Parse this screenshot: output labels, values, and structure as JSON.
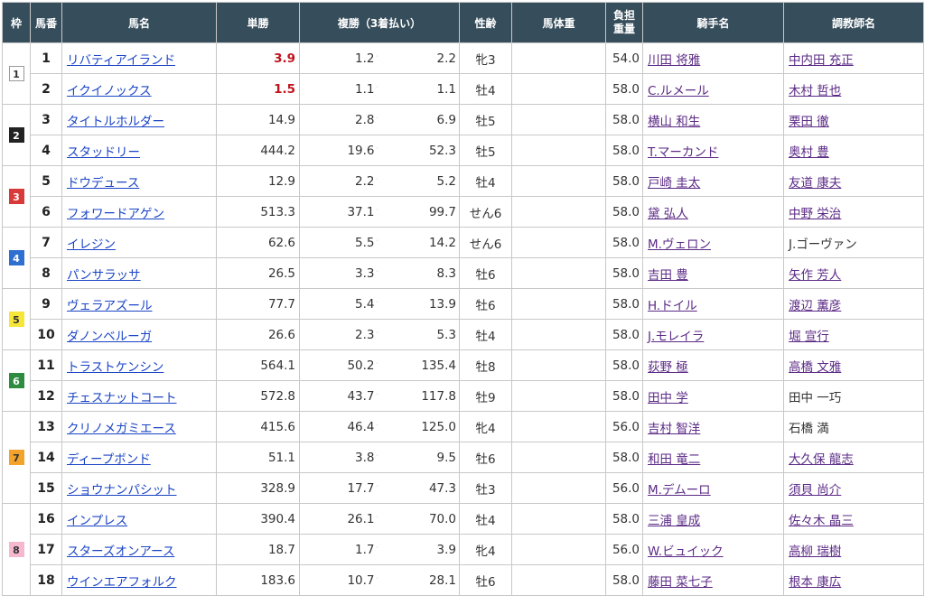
{
  "headers": {
    "waku": "枠",
    "umaban": "馬番",
    "horse": "馬名",
    "win": "単勝",
    "place": "複勝（3着払い）",
    "sexage": "性齢",
    "bodyweight": "馬体重",
    "burden_1": "負担",
    "burden_2": "重量",
    "jockey": "騎手名",
    "trainer": "調教師名"
  },
  "waku_colors": {
    "1": {
      "bg": "#ffffff",
      "fg": "#333333",
      "border": "#999999"
    },
    "2": {
      "bg": "#222222",
      "fg": "#ffffff",
      "border": "#222222"
    },
    "3": {
      "bg": "#d83a3a",
      "fg": "#ffffff",
      "border": "#d83a3a"
    },
    "4": {
      "bg": "#2f6fd0",
      "fg": "#ffffff",
      "border": "#2f6fd0"
    },
    "5": {
      "bg": "#f6e63a",
      "fg": "#333333",
      "border": "#f6e63a"
    },
    "6": {
      "bg": "#2e8b3f",
      "fg": "#ffffff",
      "border": "#2e8b3f"
    },
    "7": {
      "bg": "#f3a32a",
      "fg": "#333333",
      "border": "#f3a32a"
    },
    "8": {
      "bg": "#f5b8cf",
      "fg": "#333333",
      "border": "#f5b8cf"
    }
  },
  "rows": [
    {
      "waku": "1",
      "num": "1",
      "horse": "リバティアイランド",
      "win": "3.9",
      "fav": true,
      "plo": "1.2",
      "phi": "2.2",
      "sex": "牝3",
      "bw": "",
      "wt": "54.0",
      "jockey": "川田 将雅",
      "jockey_link": true,
      "trainer": "中内田 充正",
      "trainer_link": true
    },
    {
      "waku": "1",
      "num": "2",
      "horse": "イクイノックス",
      "win": "1.5",
      "fav": true,
      "plo": "1.1",
      "phi": "1.1",
      "sex": "牡4",
      "bw": "",
      "wt": "58.0",
      "jockey": "C.ルメール",
      "jockey_link": true,
      "trainer": "木村 哲也",
      "trainer_link": true
    },
    {
      "waku": "2",
      "num": "3",
      "horse": "タイトルホルダー",
      "win": "14.9",
      "fav": false,
      "plo": "2.8",
      "phi": "6.9",
      "sex": "牡5",
      "bw": "",
      "wt": "58.0",
      "jockey": "横山 和生",
      "jockey_link": true,
      "trainer": "栗田 徹",
      "trainer_link": true
    },
    {
      "waku": "2",
      "num": "4",
      "horse": "スタッドリー",
      "win": "444.2",
      "fav": false,
      "plo": "19.6",
      "phi": "52.3",
      "sex": "牡5",
      "bw": "",
      "wt": "58.0",
      "jockey": "T.マーカンド",
      "jockey_link": true,
      "trainer": "奥村 豊",
      "trainer_link": true
    },
    {
      "waku": "3",
      "num": "5",
      "horse": "ドウデュース",
      "win": "12.9",
      "fav": false,
      "plo": "2.2",
      "phi": "5.2",
      "sex": "牡4",
      "bw": "",
      "wt": "58.0",
      "jockey": "戸崎 圭太",
      "jockey_link": true,
      "trainer": "友道 康夫",
      "trainer_link": true
    },
    {
      "waku": "3",
      "num": "6",
      "horse": "フォワードアゲン",
      "win": "513.3",
      "fav": false,
      "plo": "37.1",
      "phi": "99.7",
      "sex": "せん6",
      "bw": "",
      "wt": "58.0",
      "jockey": "黛 弘人",
      "jockey_link": true,
      "trainer": "中野 栄治",
      "trainer_link": true
    },
    {
      "waku": "4",
      "num": "7",
      "horse": "イレジン",
      "win": "62.6",
      "fav": false,
      "plo": "5.5",
      "phi": "14.2",
      "sex": "せん6",
      "bw": "",
      "wt": "58.0",
      "jockey": "M.ヴェロン",
      "jockey_link": true,
      "trainer": "J.ゴーヴァン",
      "trainer_link": false
    },
    {
      "waku": "4",
      "num": "8",
      "horse": "パンサラッサ",
      "win": "26.5",
      "fav": false,
      "plo": "3.3",
      "phi": "8.3",
      "sex": "牡6",
      "bw": "",
      "wt": "58.0",
      "jockey": "吉田 豊",
      "jockey_link": true,
      "trainer": "矢作 芳人",
      "trainer_link": true
    },
    {
      "waku": "5",
      "num": "9",
      "horse": "ヴェラアズール",
      "win": "77.7",
      "fav": false,
      "plo": "5.4",
      "phi": "13.9",
      "sex": "牡6",
      "bw": "",
      "wt": "58.0",
      "jockey": "H.ドイル",
      "jockey_link": true,
      "trainer": "渡辺 薫彦",
      "trainer_link": true
    },
    {
      "waku": "5",
      "num": "10",
      "horse": "ダノンベルーガ",
      "win": "26.6",
      "fav": false,
      "plo": "2.3",
      "phi": "5.3",
      "sex": "牡4",
      "bw": "",
      "wt": "58.0",
      "jockey": "J.モレイラ",
      "jockey_link": true,
      "trainer": "堀 宣行",
      "trainer_link": true
    },
    {
      "waku": "6",
      "num": "11",
      "horse": "トラストケンシン",
      "win": "564.1",
      "fav": false,
      "plo": "50.2",
      "phi": "135.4",
      "sex": "牡8",
      "bw": "",
      "wt": "58.0",
      "jockey": "荻野 極",
      "jockey_link": true,
      "trainer": "高橋 文雅",
      "trainer_link": true
    },
    {
      "waku": "6",
      "num": "12",
      "horse": "チェスナットコート",
      "win": "572.8",
      "fav": false,
      "plo": "43.7",
      "phi": "117.8",
      "sex": "牡9",
      "bw": "",
      "wt": "58.0",
      "jockey": "田中 学",
      "jockey_link": true,
      "trainer": "田中 一巧",
      "trainer_link": false
    },
    {
      "waku": "7",
      "num": "13",
      "horse": "クリノメガミエース",
      "win": "415.6",
      "fav": false,
      "plo": "46.4",
      "phi": "125.0",
      "sex": "牝4",
      "bw": "",
      "wt": "56.0",
      "jockey": "吉村 智洋",
      "jockey_link": true,
      "trainer": "石橋 満",
      "trainer_link": false
    },
    {
      "waku": "7",
      "num": "14",
      "horse": "ディープボンド",
      "win": "51.1",
      "fav": false,
      "plo": "3.8",
      "phi": "9.5",
      "sex": "牡6",
      "bw": "",
      "wt": "58.0",
      "jockey": "和田 竜二",
      "jockey_link": true,
      "trainer": "大久保 龍志",
      "trainer_link": true
    },
    {
      "waku": "7",
      "num": "15",
      "horse": "ショウナンパシット",
      "win": "328.9",
      "fav": false,
      "plo": "17.7",
      "phi": "47.3",
      "sex": "牡3",
      "bw": "",
      "wt": "56.0",
      "jockey": "M.デムーロ",
      "jockey_link": true,
      "trainer": "須貝 尚介",
      "trainer_link": true
    },
    {
      "waku": "8",
      "num": "16",
      "horse": "インプレス",
      "win": "390.4",
      "fav": false,
      "plo": "26.1",
      "phi": "70.0",
      "sex": "牡4",
      "bw": "",
      "wt": "58.0",
      "jockey": "三浦 皇成",
      "jockey_link": true,
      "trainer": "佐々木 晶三",
      "trainer_link": true
    },
    {
      "waku": "8",
      "num": "17",
      "horse": "スターズオンアース",
      "win": "18.7",
      "fav": false,
      "plo": "1.7",
      "phi": "3.9",
      "sex": "牝4",
      "bw": "",
      "wt": "56.0",
      "jockey": "W.ビュイック",
      "jockey_link": true,
      "trainer": "高柳 瑞樹",
      "trainer_link": true
    },
    {
      "waku": "8",
      "num": "18",
      "horse": "ウインエアフォルク",
      "win": "183.6",
      "fav": false,
      "plo": "10.7",
      "phi": "28.1",
      "sex": "牡6",
      "bw": "",
      "wt": "58.0",
      "jockey": "藤田 菜七子",
      "jockey_link": true,
      "trainer": "根本 康広",
      "trainer_link": true
    }
  ]
}
